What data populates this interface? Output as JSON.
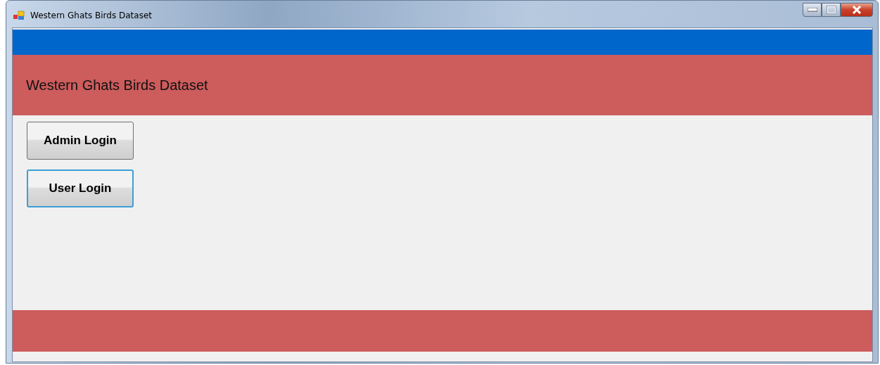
{
  "window": {
    "title": "Western Ghats Birds Dataset"
  },
  "header": {
    "title": "Western Ghats Birds Dataset"
  },
  "buttons": [
    {
      "label": "Admin Login",
      "focused": false
    },
    {
      "label": "User Login",
      "focused": true
    }
  ]
}
